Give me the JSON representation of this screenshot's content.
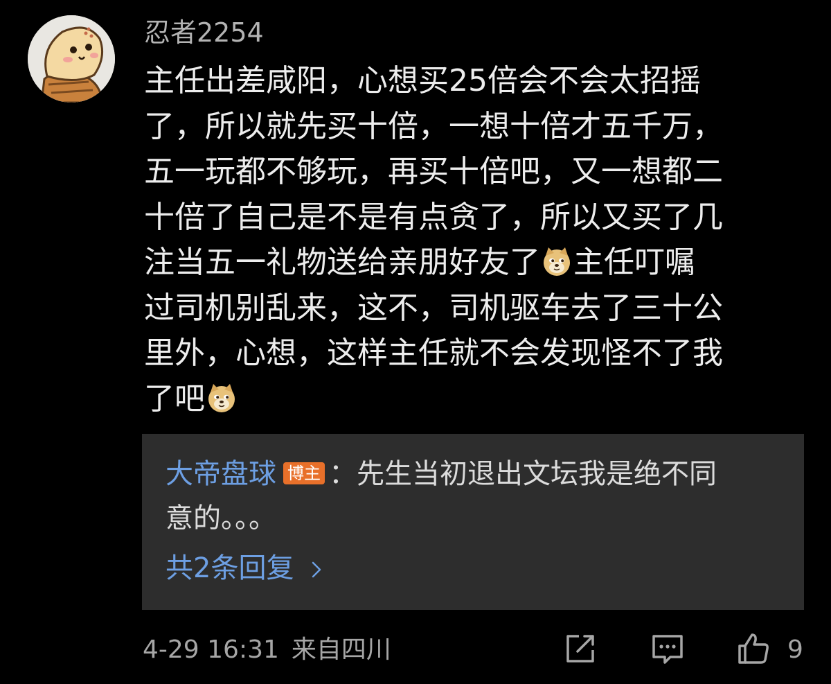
{
  "comment": {
    "username": "忍者2254",
    "text_lines": [
      "主任出差咸阳，心想买25倍会不会太招摇",
      "了，所以就先买十倍，一想十倍才五千万，",
      "五一玩都不够玩，再买十倍吧，又一想都二",
      "十倍了自己是不是有点贪了，所以又买了几"
    ],
    "line5_before_emoji": "注当五一礼物送给亲朋好友了",
    "line5_after_emoji": "主任叮嘱",
    "line6": "过司机别乱来，这不，司机驱车去了三十公",
    "line7": "里外，心想，这样主任就不会发现怪不了我",
    "line8_before_emoji": "了吧",
    "emoji_name": "doge-icon"
  },
  "reply": {
    "author": "大帝盘球",
    "badge": "博主",
    "separator": "：",
    "line1": "先生当初退出文坛我是绝不同",
    "line2": "意的。。。",
    "more_label": "共2条回复"
  },
  "footer": {
    "timestamp": "4-29 16:31",
    "location": "来自四川",
    "like_count": "9"
  },
  "colors": {
    "background": "#000000",
    "text": "#ededed",
    "meta": "#a6a6a6",
    "link": "#6d9fe3",
    "badge": "#e8702a",
    "reply_bg": "#2d2d2d"
  }
}
